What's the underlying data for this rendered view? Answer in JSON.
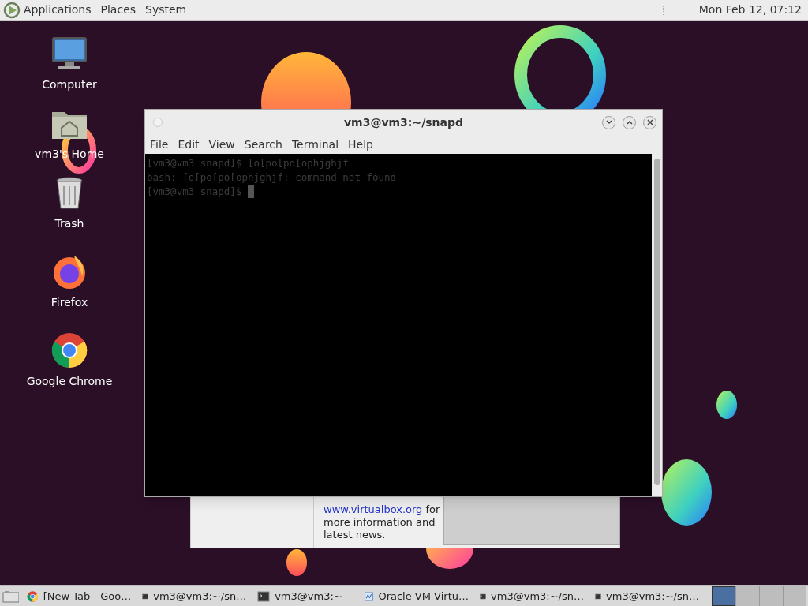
{
  "top_panel": {
    "menus": [
      "Applications",
      "Places",
      "System"
    ],
    "clock": "Mon Feb 12, 07:12"
  },
  "desktop_icons": [
    {
      "kind": "computer",
      "label": "Computer"
    },
    {
      "kind": "home",
      "label": "vm3's Home"
    },
    {
      "kind": "trash",
      "label": "Trash"
    },
    {
      "kind": "firefox",
      "label": "Firefox"
    },
    {
      "kind": "chrome",
      "label": "Google Chrome"
    }
  ],
  "background_window": {
    "lines": [
      {
        "text": "www.virtualbox.org",
        "link": true,
        "after": " for"
      },
      {
        "text": "more information and"
      },
      {
        "text": "latest news."
      }
    ]
  },
  "terminal": {
    "title": "vm3@vm3:~/snapd",
    "menus": [
      "File",
      "Edit",
      "View",
      "Search",
      "Terminal",
      "Help"
    ],
    "lines": [
      "[vm3@vm3 snapd]$ [o[po[po[ophjghjf",
      "bash: [o[po[po[ophjghjf: command not found",
      "[vm3@vm3 snapd]$ "
    ]
  },
  "taskbar": {
    "items": [
      {
        "kind": "chrome",
        "label": "[New Tab - Goo…"
      },
      {
        "kind": "terminal",
        "label": "vm3@vm3:~/sn…"
      },
      {
        "kind": "terminal",
        "label": "vm3@vm3:~"
      },
      {
        "kind": "vbox",
        "label": "Oracle VM Virtu…"
      },
      {
        "kind": "terminal",
        "label": "vm3@vm3:~/sn…"
      },
      {
        "kind": "terminal",
        "label": "vm3@vm3:~/sn…"
      }
    ]
  }
}
